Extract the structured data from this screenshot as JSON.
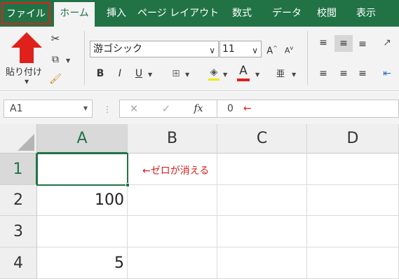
{
  "tabs": [
    "ファイル",
    "ホーム",
    "挿入",
    "ページ レイアウト",
    "数式",
    "データ",
    "校閲",
    "表示"
  ],
  "ribbon": {
    "paste_label": "貼り付け",
    "font_name": "游ゴシック",
    "font_size": "11",
    "bold": "B",
    "italic": "I",
    "underline": "U",
    "font_color_letter": "A",
    "grow_font": "A",
    "shrink_font": "A"
  },
  "formula_bar": {
    "name_box": "A1",
    "fx": "fx",
    "cancel": "✕",
    "enter": "✓",
    "value": "0",
    "arrow": "←"
  },
  "sheet": {
    "columns": [
      "A",
      "B",
      "C",
      "D"
    ],
    "rows": [
      "1",
      "2",
      "3",
      "4"
    ],
    "cells": {
      "A2": "100",
      "A4": "5"
    },
    "note": "←ゼロが消える"
  },
  "colors": {
    "excel_green": "#217346",
    "highlight_red": "#e0201a"
  }
}
